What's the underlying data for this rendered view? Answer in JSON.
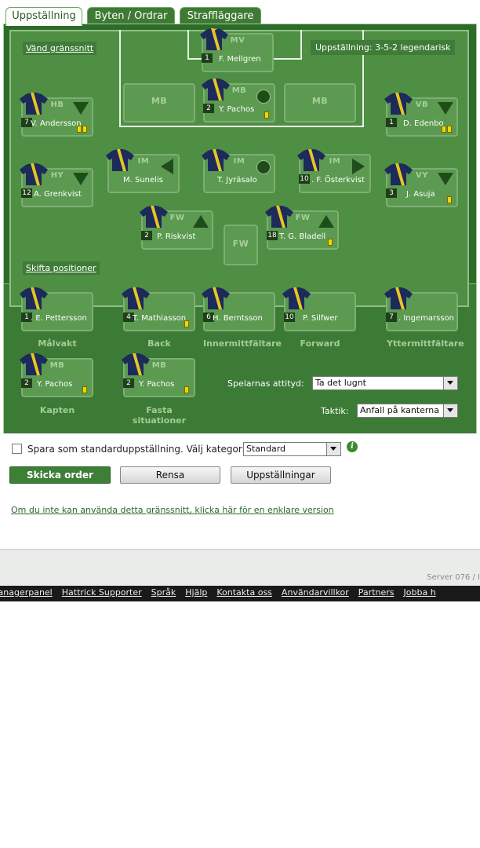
{
  "tabs": [
    "Uppställning",
    "Byten / Ordrar",
    "Straffläggare"
  ],
  "field": {
    "flip_link": "Vänd gränssnitt",
    "formation": "Uppställning: 3-5-2 legendarisk",
    "shift_link": "Skifta positioner",
    "players": [
      {
        "pos": "MV",
        "num": "1",
        "name": "F. Mellgren"
      },
      {
        "pos": "MB",
        "num": "2",
        "name": "Y. Pachos"
      },
      {
        "pos": "HB",
        "num": "7",
        "name": "V. Andersson"
      },
      {
        "pos": "VB",
        "num": "1",
        "name": "D. Edenbo"
      },
      {
        "pos": "HY",
        "num": "12",
        "name": "A. Grenkvist"
      },
      {
        "pos": "IM",
        "num": "",
        "name": "M. Sunelis"
      },
      {
        "pos": "IM",
        "num": "",
        "name": "T. Jyräsalo"
      },
      {
        "pos": "IM",
        "num": "10",
        "name": ". F. Österkvist"
      },
      {
        "pos": "VY",
        "num": "3",
        "name": "J. Asuja"
      },
      {
        "pos": "FW",
        "num": "2",
        "name": "P. Riskvist"
      },
      {
        "pos": "FW",
        "num": "18",
        "name": "T. G. Bladell"
      }
    ],
    "empty_slots": [
      "MB",
      "MB",
      "FW"
    ]
  },
  "bench": {
    "subs": [
      {
        "num": "1",
        "name": ". E. Pettersson",
        "label": "Målvakt"
      },
      {
        "num": "4",
        "name": "T. Mathiasson",
        "label": "Back"
      },
      {
        "num": "6",
        "name": "H. Berntsson",
        "label": "Innermittfältare"
      },
      {
        "num": "10",
        "name": "P. Silfwer",
        "label": "Forward"
      },
      {
        "num": "7",
        "name": ". Ingemarsson",
        "label": "Yttermittfältare"
      }
    ],
    "captain": {
      "pos": "MB",
      "num": "2",
      "name": "Y. Pachos",
      "label": "Kapten"
    },
    "setpieces": {
      "pos": "MB",
      "num": "2",
      "name": "Y. Pachos",
      "label": "Fasta situationer"
    },
    "attitude_label": "Spelarnas attityd:",
    "attitude_value": "Ta det lugnt",
    "tactic_label": "Taktik:",
    "tactic_value": "Anfall på kanterna"
  },
  "form": {
    "save_default_label": "Spara som standarduppställning. Välj kategori.",
    "category_value": "Standard",
    "send_button": "Skicka order",
    "clear_button": "Rensa",
    "lineups_button": "Uppställningar",
    "simple_link": "Om du inte kan använda detta gränssnitt, klicka här för en enklare version"
  },
  "footer": {
    "server": "Server 076 / I",
    "links": [
      "Managerpanel",
      "Hattrick Supporter",
      "Språk",
      "Hjälp",
      "Kontakta oss",
      "Användarvillkor",
      "Partners",
      "Jobba h"
    ]
  }
}
